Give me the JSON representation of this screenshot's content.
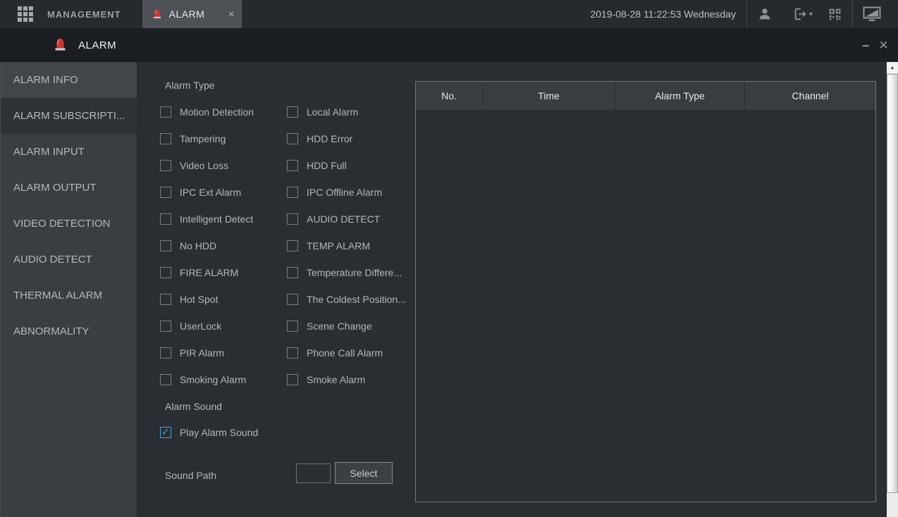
{
  "topbar": {
    "menu": "MANAGEMENT",
    "tab": {
      "label": "ALARM",
      "close_glyph": "×"
    },
    "datetime": "2019-08-28 11:22:53 Wednesday"
  },
  "titlebar": {
    "title": "ALARM",
    "minimize_glyph": "–",
    "close_glyph": "×"
  },
  "sidebar": {
    "items": [
      {
        "label": "ALARM INFO",
        "selected": false
      },
      {
        "label": "ALARM SUBSCRIPTI...",
        "selected": true
      },
      {
        "label": "ALARM INPUT",
        "selected": false
      },
      {
        "label": "ALARM OUTPUT",
        "selected": false
      },
      {
        "label": "VIDEO DETECTION",
        "selected": false
      },
      {
        "label": "AUDIO DETECT",
        "selected": false
      },
      {
        "label": "THERMAL ALARM",
        "selected": false
      },
      {
        "label": "ABNORMALITY",
        "selected": false
      }
    ]
  },
  "form": {
    "alarm_type_label": "Alarm Type",
    "alarm_types": [
      {
        "label": "Motion Detection",
        "checked": false
      },
      {
        "label": "Local Alarm",
        "checked": false
      },
      {
        "label": "Tampering",
        "checked": false
      },
      {
        "label": "HDD Error",
        "checked": false
      },
      {
        "label": "Video Loss",
        "checked": false
      },
      {
        "label": "HDD Full",
        "checked": false
      },
      {
        "label": "IPC Ext Alarm",
        "checked": false
      },
      {
        "label": "IPC Offline Alarm",
        "checked": false
      },
      {
        "label": "Intelligent Detect",
        "checked": false
      },
      {
        "label": "AUDIO DETECT",
        "checked": false
      },
      {
        "label": "No HDD",
        "checked": false
      },
      {
        "label": "TEMP ALARM",
        "checked": false
      },
      {
        "label": "FIRE ALARM",
        "checked": false
      },
      {
        "label": "Temperature Differe...",
        "checked": false
      },
      {
        "label": "Hot Spot",
        "checked": false
      },
      {
        "label": "The Coldest Position...",
        "checked": false
      },
      {
        "label": "UserLock",
        "checked": false
      },
      {
        "label": "Scene Change",
        "checked": false
      },
      {
        "label": "PIR Alarm",
        "checked": false
      },
      {
        "label": "Phone Call Alarm",
        "checked": false
      },
      {
        "label": "Smoking Alarm",
        "checked": false
      },
      {
        "label": "Smoke Alarm",
        "checked": false
      }
    ],
    "alarm_sound_label": "Alarm Sound",
    "play_alarm_sound": {
      "label": "Play Alarm Sound",
      "checked": true
    },
    "sound_path_label": "Sound Path",
    "sound_path_value": "",
    "select_button_label": "Select"
  },
  "table": {
    "columns": [
      "No.",
      "Time",
      "Alarm Type",
      "Channel"
    ],
    "rows": []
  },
  "glyphs": {
    "check": "✓",
    "scroll_up": "▲",
    "caret_down": "▾"
  },
  "colors": {
    "accent_blue": "#36a3e8",
    "siren_red": "#d5342c",
    "topbar_bg": "#26292e",
    "titlebar_bg": "#1b1e22",
    "sidebar_bg": "#3a3d42",
    "selected_item_bg": "#2e3136",
    "content_bg": "#2a2d32",
    "table_header_bg": "#393c41"
  }
}
